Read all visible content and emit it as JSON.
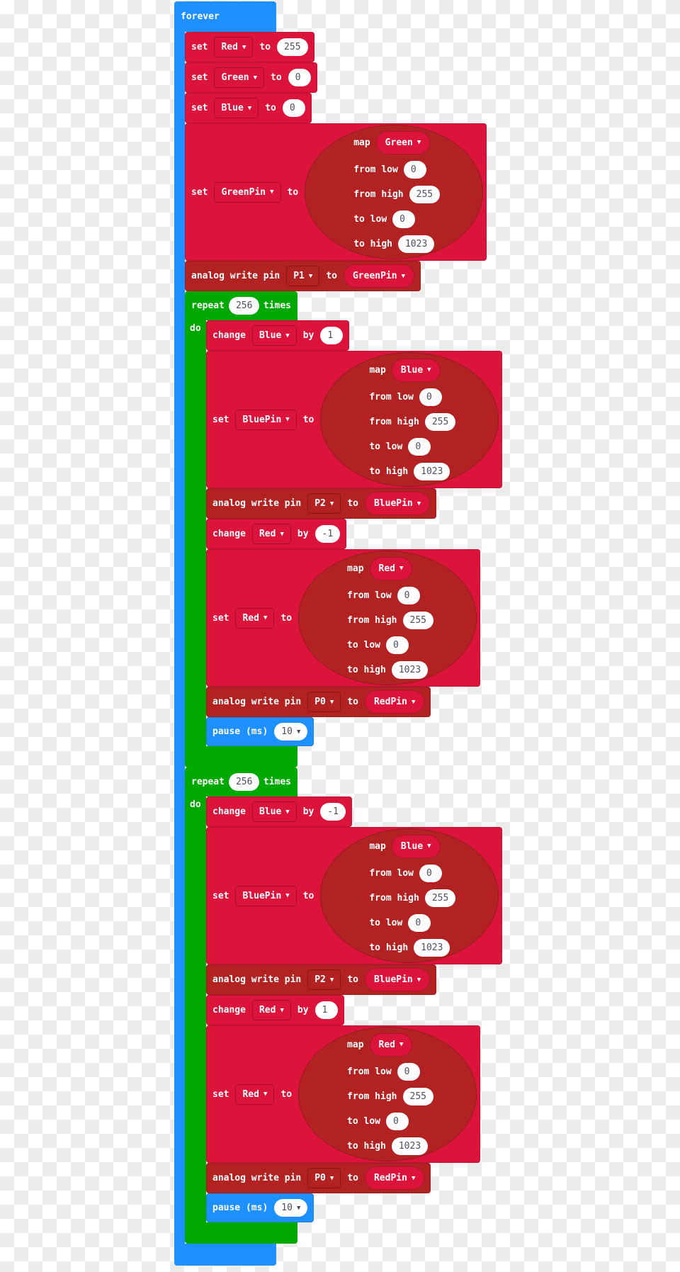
{
  "colors": {
    "loops_blue": "#1e90ff",
    "variables_red": "#dc143c",
    "pins_dark_red": "#b22222",
    "repeat_green": "#00a800"
  },
  "forever": {
    "label": "forever",
    "statements": [
      {
        "type": "set",
        "label": "set",
        "var": "Red",
        "to": "to",
        "value": "255"
      },
      {
        "type": "set",
        "label": "set",
        "var": "Green",
        "to": "to",
        "value": "0"
      },
      {
        "type": "set",
        "label": "set",
        "var": "Blue",
        "to": "to",
        "value": "0"
      },
      {
        "type": "set_map",
        "label": "set",
        "var": "GreenPin",
        "to": "to",
        "map": {
          "label": "map",
          "var": "Green",
          "rows": [
            {
              "label": "from low",
              "value": "0"
            },
            {
              "label": "from high",
              "value": "255"
            },
            {
              "label": "to low",
              "value": "0"
            },
            {
              "label": "to high",
              "value": "1023"
            }
          ]
        }
      },
      {
        "type": "analog",
        "label": "analog write pin",
        "pin": "P1",
        "to": "to",
        "value": "GreenPin"
      },
      {
        "type": "repeat",
        "label": "repeat",
        "count": "256",
        "times": "times",
        "do": "do",
        "statements": [
          {
            "type": "change",
            "label": "change",
            "var": "Blue",
            "by": "by",
            "value": "1"
          },
          {
            "type": "set_map",
            "label": "set",
            "var": "BluePin",
            "to": "to",
            "map": {
              "label": "map",
              "var": "Blue",
              "rows": [
                {
                  "label": "from low",
                  "value": "0"
                },
                {
                  "label": "from high",
                  "value": "255"
                },
                {
                  "label": "to low",
                  "value": "0"
                },
                {
                  "label": "to high",
                  "value": "1023"
                }
              ]
            }
          },
          {
            "type": "analog",
            "label": "analog write pin",
            "pin": "P2",
            "to": "to",
            "value": "BluePin"
          },
          {
            "type": "change",
            "label": "change",
            "var": "Red",
            "by": "by",
            "value": "-1"
          },
          {
            "type": "set_map",
            "label": "set",
            "var": "Red",
            "to": "to",
            "map": {
              "label": "map",
              "var": "Red",
              "rows": [
                {
                  "label": "from low",
                  "value": "0"
                },
                {
                  "label": "from high",
                  "value": "255"
                },
                {
                  "label": "to low",
                  "value": "0"
                },
                {
                  "label": "to high",
                  "value": "1023"
                }
              ]
            }
          },
          {
            "type": "analog",
            "label": "analog write pin",
            "pin": "P0",
            "to": "to",
            "value": "RedPin"
          },
          {
            "type": "pause",
            "label": "pause (ms)",
            "value": "10"
          }
        ]
      },
      {
        "type": "repeat",
        "label": "repeat",
        "count": "256",
        "times": "times",
        "do": "do",
        "statements": [
          {
            "type": "change",
            "label": "change",
            "var": "Blue",
            "by": "by",
            "value": "-1"
          },
          {
            "type": "set_map",
            "label": "set",
            "var": "BluePin",
            "to": "to",
            "map": {
              "label": "map",
              "var": "Blue",
              "rows": [
                {
                  "label": "from low",
                  "value": "0"
                },
                {
                  "label": "from high",
                  "value": "255"
                },
                {
                  "label": "to low",
                  "value": "0"
                },
                {
                  "label": "to high",
                  "value": "1023"
                }
              ]
            }
          },
          {
            "type": "analog",
            "label": "analog write pin",
            "pin": "P2",
            "to": "to",
            "value": "BluePin"
          },
          {
            "type": "change",
            "label": "change",
            "var": "Red",
            "by": "by",
            "value": "1"
          },
          {
            "type": "set_map",
            "label": "set",
            "var": "Red",
            "to": "to",
            "map": {
              "label": "map",
              "var": "Red",
              "rows": [
                {
                  "label": "from low",
                  "value": "0"
                },
                {
                  "label": "from high",
                  "value": "255"
                },
                {
                  "label": "to low",
                  "value": "0"
                },
                {
                  "label": "to high",
                  "value": "1023"
                }
              ]
            }
          },
          {
            "type": "analog",
            "label": "analog write pin",
            "pin": "P0",
            "to": "to",
            "value": "RedPin"
          },
          {
            "type": "pause",
            "label": "pause (ms)",
            "value": "10"
          }
        ]
      }
    ]
  }
}
